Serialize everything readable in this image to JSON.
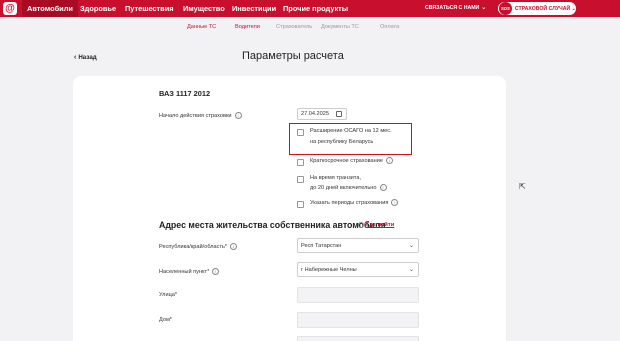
{
  "nav": {
    "logo_glyph": "@",
    "items": [
      "Автомобили",
      "Здоровье",
      "Путешествия",
      "Имущество",
      "Инвестиции",
      "Прочие продукты"
    ],
    "contact": "СВЯЗАТЬСЯ С НАМИ",
    "sos_badge": "SOS",
    "sos_label": "СТРАХОВОЙ СЛУЧАЙ"
  },
  "stepper": [
    "Данные ТС",
    "Водители",
    "Страхователь",
    "Документы ТС",
    "Оплата"
  ],
  "back_label": "Назад",
  "page_title": "Параметры расчета",
  "car_title": "ВАЗ 1117 2012",
  "start_date": {
    "label": "Начало действия страховки",
    "value": "27.04.2025"
  },
  "options": {
    "belarus_line1": "Расширение ОСАГО на 12 мес.",
    "belarus_line2": "на республику Беларусь",
    "short_term": "Краткосрочное страхование",
    "transit_line1": "На время транзита,",
    "transit_line2": "до 20 дней включительно",
    "periods": "Указать периоды страхования"
  },
  "address": {
    "title": "Адрес места жительства собственника автомобиля",
    "find_link": "Где найти",
    "region_label": "Республика/край/область*",
    "region_value": "Респ Татарстан",
    "city_label": "Населенный пункт*",
    "city_value": "г Набережные Челны",
    "street_label": "Улица*",
    "house_label": "Дом*"
  },
  "colors": {
    "brand": "#c8102e",
    "highlight": "#d0101a",
    "background": "#f2f2f4"
  },
  "icons": [
    "alfa-logo-icon",
    "calendar-icon",
    "info-icon",
    "chevron-down-icon",
    "back-arrow-icon",
    "mouse-cursor-icon"
  ]
}
